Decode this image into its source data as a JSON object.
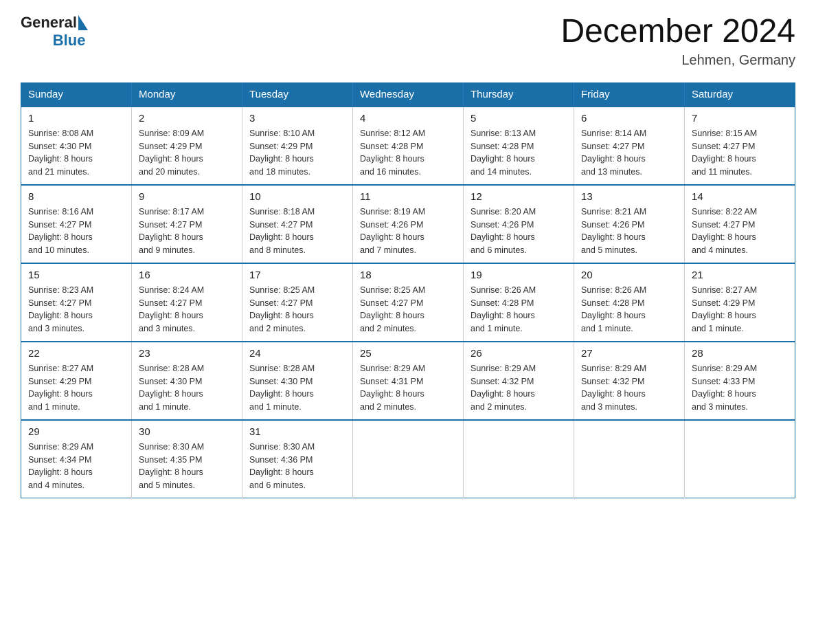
{
  "logo": {
    "general": "General",
    "blue": "Blue"
  },
  "header": {
    "month": "December 2024",
    "location": "Lehmen, Germany"
  },
  "weekdays": [
    "Sunday",
    "Monday",
    "Tuesday",
    "Wednesday",
    "Thursday",
    "Friday",
    "Saturday"
  ],
  "weeks": [
    [
      {
        "day": "1",
        "sunrise": "8:08 AM",
        "sunset": "4:30 PM",
        "daylight": "8 hours and 21 minutes."
      },
      {
        "day": "2",
        "sunrise": "8:09 AM",
        "sunset": "4:29 PM",
        "daylight": "8 hours and 20 minutes."
      },
      {
        "day": "3",
        "sunrise": "8:10 AM",
        "sunset": "4:29 PM",
        "daylight": "8 hours and 18 minutes."
      },
      {
        "day": "4",
        "sunrise": "8:12 AM",
        "sunset": "4:28 PM",
        "daylight": "8 hours and 16 minutes."
      },
      {
        "day": "5",
        "sunrise": "8:13 AM",
        "sunset": "4:28 PM",
        "daylight": "8 hours and 14 minutes."
      },
      {
        "day": "6",
        "sunrise": "8:14 AM",
        "sunset": "4:27 PM",
        "daylight": "8 hours and 13 minutes."
      },
      {
        "day": "7",
        "sunrise": "8:15 AM",
        "sunset": "4:27 PM",
        "daylight": "8 hours and 11 minutes."
      }
    ],
    [
      {
        "day": "8",
        "sunrise": "8:16 AM",
        "sunset": "4:27 PM",
        "daylight": "8 hours and 10 minutes."
      },
      {
        "day": "9",
        "sunrise": "8:17 AM",
        "sunset": "4:27 PM",
        "daylight": "8 hours and 9 minutes."
      },
      {
        "day": "10",
        "sunrise": "8:18 AM",
        "sunset": "4:27 PM",
        "daylight": "8 hours and 8 minutes."
      },
      {
        "day": "11",
        "sunrise": "8:19 AM",
        "sunset": "4:26 PM",
        "daylight": "8 hours and 7 minutes."
      },
      {
        "day": "12",
        "sunrise": "8:20 AM",
        "sunset": "4:26 PM",
        "daylight": "8 hours and 6 minutes."
      },
      {
        "day": "13",
        "sunrise": "8:21 AM",
        "sunset": "4:26 PM",
        "daylight": "8 hours and 5 minutes."
      },
      {
        "day": "14",
        "sunrise": "8:22 AM",
        "sunset": "4:27 PM",
        "daylight": "8 hours and 4 minutes."
      }
    ],
    [
      {
        "day": "15",
        "sunrise": "8:23 AM",
        "sunset": "4:27 PM",
        "daylight": "8 hours and 3 minutes."
      },
      {
        "day": "16",
        "sunrise": "8:24 AM",
        "sunset": "4:27 PM",
        "daylight": "8 hours and 3 minutes."
      },
      {
        "day": "17",
        "sunrise": "8:25 AM",
        "sunset": "4:27 PM",
        "daylight": "8 hours and 2 minutes."
      },
      {
        "day": "18",
        "sunrise": "8:25 AM",
        "sunset": "4:27 PM",
        "daylight": "8 hours and 2 minutes."
      },
      {
        "day": "19",
        "sunrise": "8:26 AM",
        "sunset": "4:28 PM",
        "daylight": "8 hours and 1 minute."
      },
      {
        "day": "20",
        "sunrise": "8:26 AM",
        "sunset": "4:28 PM",
        "daylight": "8 hours and 1 minute."
      },
      {
        "day": "21",
        "sunrise": "8:27 AM",
        "sunset": "4:29 PM",
        "daylight": "8 hours and 1 minute."
      }
    ],
    [
      {
        "day": "22",
        "sunrise": "8:27 AM",
        "sunset": "4:29 PM",
        "daylight": "8 hours and 1 minute."
      },
      {
        "day": "23",
        "sunrise": "8:28 AM",
        "sunset": "4:30 PM",
        "daylight": "8 hours and 1 minute."
      },
      {
        "day": "24",
        "sunrise": "8:28 AM",
        "sunset": "4:30 PM",
        "daylight": "8 hours and 1 minute."
      },
      {
        "day": "25",
        "sunrise": "8:29 AM",
        "sunset": "4:31 PM",
        "daylight": "8 hours and 2 minutes."
      },
      {
        "day": "26",
        "sunrise": "8:29 AM",
        "sunset": "4:32 PM",
        "daylight": "8 hours and 2 minutes."
      },
      {
        "day": "27",
        "sunrise": "8:29 AM",
        "sunset": "4:32 PM",
        "daylight": "8 hours and 3 minutes."
      },
      {
        "day": "28",
        "sunrise": "8:29 AM",
        "sunset": "4:33 PM",
        "daylight": "8 hours and 3 minutes."
      }
    ],
    [
      {
        "day": "29",
        "sunrise": "8:29 AM",
        "sunset": "4:34 PM",
        "daylight": "8 hours and 4 minutes."
      },
      {
        "day": "30",
        "sunrise": "8:30 AM",
        "sunset": "4:35 PM",
        "daylight": "8 hours and 5 minutes."
      },
      {
        "day": "31",
        "sunrise": "8:30 AM",
        "sunset": "4:36 PM",
        "daylight": "8 hours and 6 minutes."
      },
      null,
      null,
      null,
      null
    ]
  ],
  "labels": {
    "sunrise": "Sunrise:",
    "sunset": "Sunset:",
    "daylight": "Daylight:"
  }
}
